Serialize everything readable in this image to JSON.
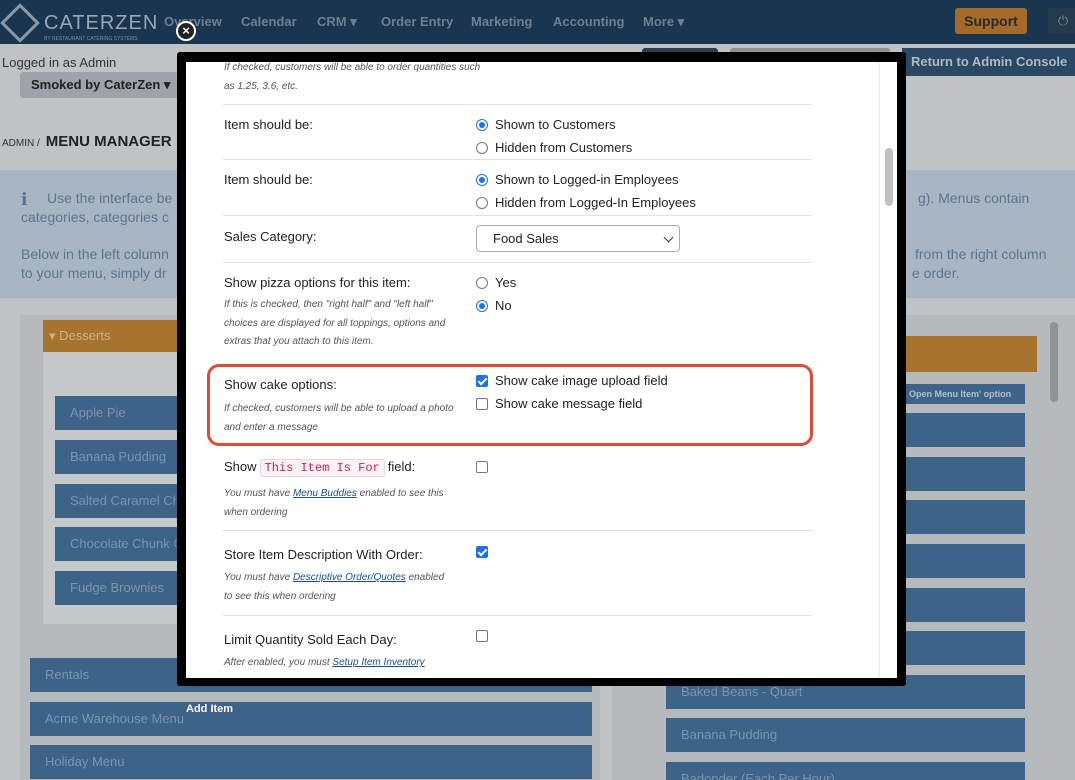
{
  "app": {
    "logo": "CATERZEN",
    "logo_sub": "BY RESTAURANT CATERING SYSTEMS",
    "nav": [
      "Overview",
      "Calendar",
      "CRM ▾",
      "Order Entry",
      "Marketing",
      "Accounting",
      "More ▾"
    ],
    "support": "Support",
    "power_icon": "⏻",
    "logged_in": "Logged in as Admin",
    "brand": "Smoked by CaterZen ▾",
    "return": "Return to Admin Console",
    "crumb_admin": "ADMIN /",
    "crumb_page": "MENU MANAGER",
    "info_lines": [
      "Use the interface be",
      "categories, categories c",
      "Below in the left column",
      "to your menu, simply dr"
    ],
    "info_right": [
      "g). Menus contain",
      "from the right column",
      "e order."
    ]
  },
  "left": {
    "category": "▾ Desserts",
    "items": [
      "Apple Pie",
      "Banana Pudding",
      "Salted Caramel Ch",
      "Chocolate Chunk C",
      "Fudge Brownies"
    ],
    "menus": [
      "Rentals",
      "Acme Warehouse Menu",
      "Holiday Menu"
    ]
  },
  "right": {
    "open_option": "Open Menu Item' option",
    "rows": [
      "Baked Beans - Quart",
      "Banana Pudding",
      "Badonder (Each Per Hour)"
    ]
  },
  "modal": {
    "close": "×",
    "add_item": "Add Item",
    "top_help": "If checked, customers will be able to order quantities such as 1.25, 3.6, etc.",
    "customers": {
      "label": "Item should be:",
      "opt1": "Shown to Customers",
      "opt2": "Hidden from Customers"
    },
    "employees": {
      "label": "Item should be:",
      "opt1": "Shown to Logged-in Employees",
      "opt2": "Hidden from Logged-In Employees"
    },
    "sales": {
      "label": "Sales Category:",
      "value": "Food Sales"
    },
    "pizza": {
      "label": "Show pizza options for this item:",
      "help": "If this is checked, then \"right half\" and \"left half\" choices are displayed for all toppings, options and extras that you attach to this item.",
      "yes": "Yes",
      "no": "No"
    },
    "cake": {
      "label": "Show cake options:",
      "help": "If checked, customers will be able to upload a photo and enter a message",
      "opt1": "Show cake image upload field",
      "opt2": "Show cake message field"
    },
    "itemfor": {
      "label_pre": "Show",
      "code": "This Item Is For",
      "label_post": "field:",
      "help_pre": "You must have",
      "link": "Menu Buddies",
      "help_post": "enabled to see this when ordering"
    },
    "store": {
      "label": "Store Item Description With Order:",
      "help_pre": "You must have",
      "link": "Descriptive Order/Quotes",
      "help_post": "enabled to see this when ordering"
    },
    "limit": {
      "label": "Limit Quantity Sold Each Day:",
      "help_pre": "After enabled, you must",
      "link": "Setup Item Inventory"
    }
  }
}
